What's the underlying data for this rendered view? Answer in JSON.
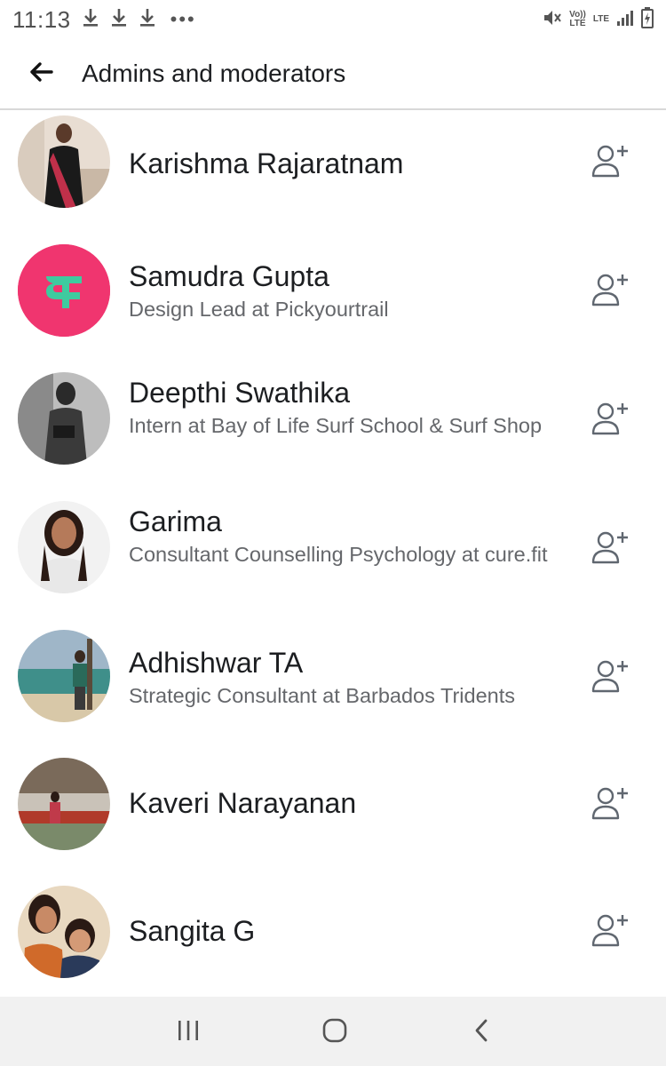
{
  "status_bar": {
    "time": "11:13",
    "more": "•••",
    "volte": "Vo)) LTE",
    "lte": "LTE"
  },
  "header": {
    "title": "Admins and moderators",
    "back_icon": "arrow-left-icon"
  },
  "members": [
    {
      "name": "Karishma Rajaratnam",
      "subtitle": ""
    },
    {
      "name": "Samudra Gupta",
      "subtitle": "Design Lead at Pickyourtrail"
    },
    {
      "name": "Deepthi Swathika",
      "subtitle": "Intern at Bay of Life  Surf School & Surf Shop"
    },
    {
      "name": "Garima",
      "subtitle": "Consultant Counselling Psychology at cure.fit"
    },
    {
      "name": "Adhishwar TA",
      "subtitle": "Strategic Consultant at Barbados Tridents"
    },
    {
      "name": "Kaveri Narayanan",
      "subtitle": ""
    },
    {
      "name": "Sangita G",
      "subtitle": ""
    }
  ],
  "colors": {
    "samudra_avatar_bg": "#f0356f",
    "samudra_logo": "#3ecb9f",
    "text_primary": "#1c1e21",
    "text_secondary": "#65676b",
    "nav_bar_bg": "#f1f1f1"
  },
  "icons": {
    "add_friend": "add-person-icon",
    "nav_recent": "recent-apps-icon",
    "nav_home": "home-icon",
    "nav_back": "back-chevron-icon"
  }
}
